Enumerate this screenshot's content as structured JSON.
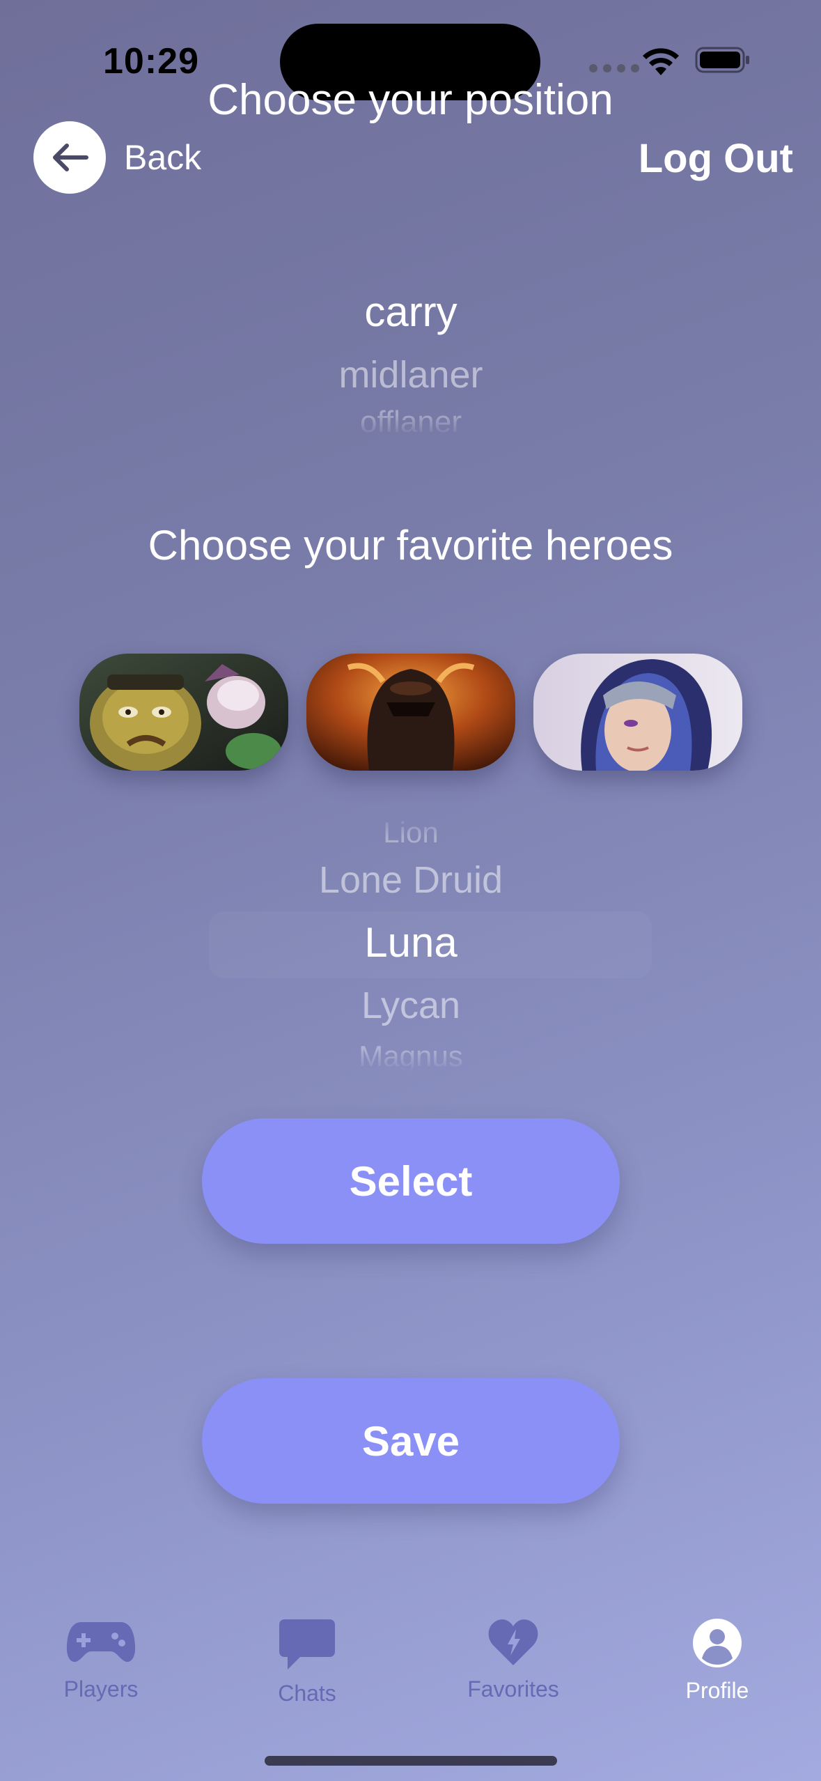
{
  "status_bar": {
    "time": "10:29"
  },
  "nav": {
    "title": "Choose your position",
    "back_label": "Back",
    "logout_label": "Log Out"
  },
  "position_picker": {
    "selected": "carry",
    "next": "midlaner",
    "after": "offlaner"
  },
  "heroes_section": {
    "title": "Choose your favorite heroes"
  },
  "hero_cards": [
    {
      "name": "Alchemist"
    },
    {
      "name": "Chaos Knight"
    },
    {
      "name": "Luna"
    }
  ],
  "hero_picker": {
    "far_above": "Lion",
    "above": "Lone Druid",
    "selected": "Luna",
    "below": "Lycan",
    "far_below": "Magnus"
  },
  "buttons": {
    "select_label": "Select",
    "save_label": "Save"
  },
  "tab_bar": {
    "tabs": [
      {
        "label": "Players",
        "icon": "gamepad-icon",
        "active": false
      },
      {
        "label": "Chats",
        "icon": "chat-bubble-icon",
        "active": false
      },
      {
        "label": "Favorites",
        "icon": "heart-bolt-icon",
        "active": false
      },
      {
        "label": "Profile",
        "icon": "person-circle-icon",
        "active": true
      }
    ]
  },
  "colors": {
    "accent_button": "#8b90f7",
    "tab_inactive": "#6669b4",
    "tab_active": "#ffffff"
  }
}
